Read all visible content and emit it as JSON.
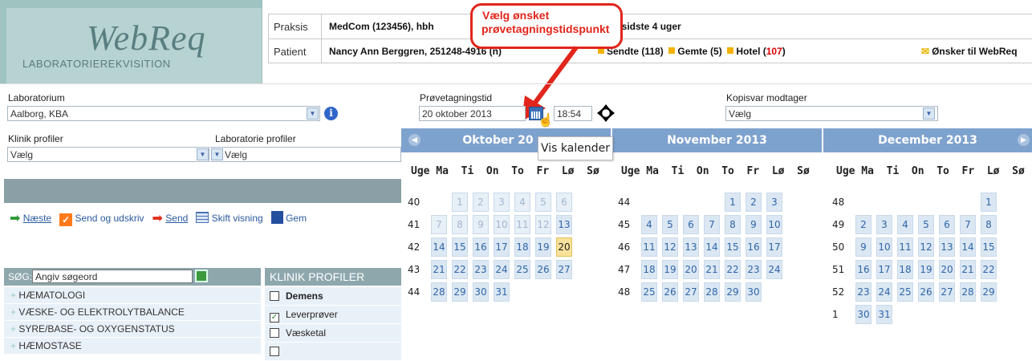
{
  "logo": {
    "title": "WebReq",
    "subtitle": "LABORATORIEREKVISITION"
  },
  "header": {
    "praksis_label": "Praksis",
    "praksis_value": "MedCom (123456), hbh",
    "patient_label": "Patient",
    "patient_value": "Nancy Ann Berggren, 251248-4916 (n)",
    "de_sidste": "De sidste 4 uger",
    "sendte": "Sendte (118)",
    "gemte": "Gemte (5)",
    "hotel_label": "Hotel (",
    "hotel_count": "107",
    "hotel_close": ")",
    "onsker": "Ønsker til WebReq"
  },
  "callout": {
    "line1": "Vælg ønsket",
    "line2": "prøvetagningstidspunkt"
  },
  "form": {
    "laboratorium_label": "Laboratorium",
    "laboratorium_value": "Aalborg, KBA",
    "klinik_profiler_label": "Klinik profiler",
    "klinik_profiler_value": "Vælg",
    "lab_profiler_label": "Laboratorie profiler",
    "lab_profiler_value": "Vælg",
    "provetagningstid_label": "Prøvetagningstid",
    "date_value": "20 oktober 2013",
    "time_value": "18:54",
    "kopisvar_label": "Kopisvar modtager",
    "kopisvar_value": "Vælg"
  },
  "toolbar": {
    "naeste": "Næste",
    "send_udskriv": "Send og udskriv",
    "send": "Send",
    "skift_visning": "Skift visning",
    "gem": "Gem"
  },
  "sidebar": {
    "search_label": "SØG:",
    "search_placeholder": "Angiv søgeord",
    "items": [
      "HÆMATOLOGI",
      "VÆSKE- OG ELEKTROLYTBALANCE",
      "SYRE/BASE- OG OXYGENSTATUS",
      "HÆMOSTASE"
    ]
  },
  "klinik_profiler": {
    "header": "KLINIK PROFILER",
    "items": [
      {
        "label": "Demens",
        "checked": false
      },
      {
        "label": "Leverprøver",
        "checked": true
      },
      {
        "label": "Væsketal",
        "checked": false
      }
    ]
  },
  "tooltip": "Vis kalender",
  "calendar": {
    "dow_header": "Uge Ma  Ti  On  To  Fr  Lø  Sø",
    "months": [
      {
        "title": "Oktober 20",
        "weeks": [
          "40",
          "41",
          "42",
          "43",
          "44"
        ]
      },
      {
        "title": "November 2013",
        "weeks": [
          "44",
          "45",
          "46",
          "47",
          "48"
        ]
      },
      {
        "title": "December 2013",
        "weeks": [
          "48",
          "49",
          "50",
          "51",
          "52",
          "1"
        ]
      }
    ],
    "today_color": "#f8e19a",
    "header_color": "#7ea2ce"
  }
}
